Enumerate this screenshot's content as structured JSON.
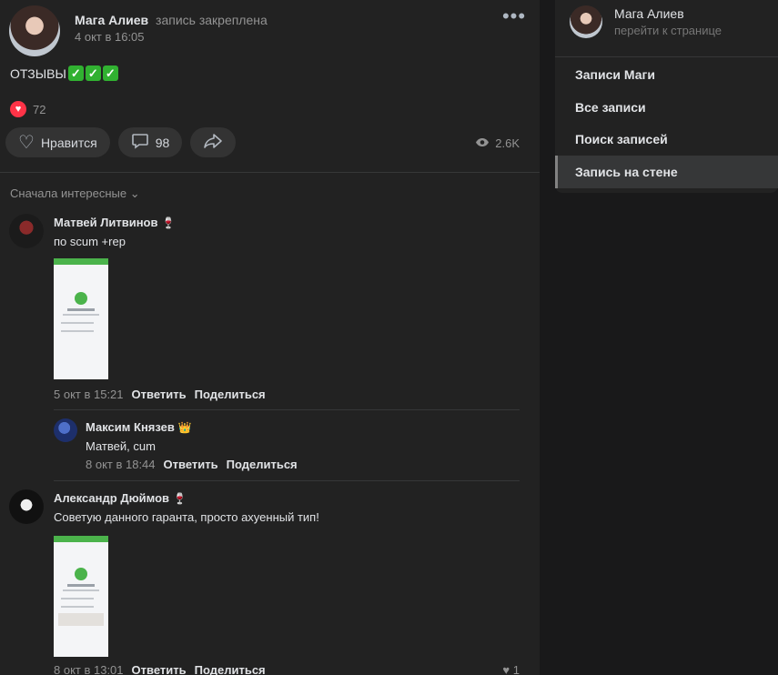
{
  "post": {
    "author": "Мага Алиев",
    "pinned_label": "запись закреплена",
    "date": "4 окт в 16:05",
    "more_icon": "•••",
    "text": "ОТЗЫВЫ",
    "text_checks": [
      "✓",
      "✓",
      "✓"
    ],
    "reactions_count": "72",
    "like_label": "Нравится",
    "comments_count": "98",
    "views_count": "2.6K"
  },
  "comments": {
    "sort_label": "Сначала интересные ⌄",
    "items": [
      {
        "author": "Матвей Литвинов",
        "text": "по scum +rep",
        "date": "5 окт в 15:21",
        "reply_label": "Ответить",
        "share_label": "Поделиться",
        "emoji": "🍷"
      },
      {
        "author": "Максим Князев",
        "text": "Матвей, cum",
        "date": "8 окт в 18:44",
        "reply_label": "Ответить",
        "share_label": "Поделиться",
        "emoji": "👑"
      },
      {
        "author": "Александр Дюймов",
        "text": "Советую данного гаранта, просто ахуенный тип!",
        "date": "8 окт в 13:01",
        "reply_label": "Ответить",
        "share_label": "Поделиться",
        "emoji": "🍷",
        "likes": "1"
      }
    ]
  },
  "sidebar": {
    "name": "Мага Алиев",
    "profile_link": "перейти к странице",
    "items": [
      {
        "label": "Записи Маги"
      },
      {
        "label": "Все записи"
      },
      {
        "label": "Поиск записей"
      },
      {
        "label": "Запись на стене"
      }
    ]
  },
  "colors": {
    "background": "#19191a",
    "panel": "#222222",
    "like_red": "#ff3347",
    "check_green": "#31b131"
  }
}
